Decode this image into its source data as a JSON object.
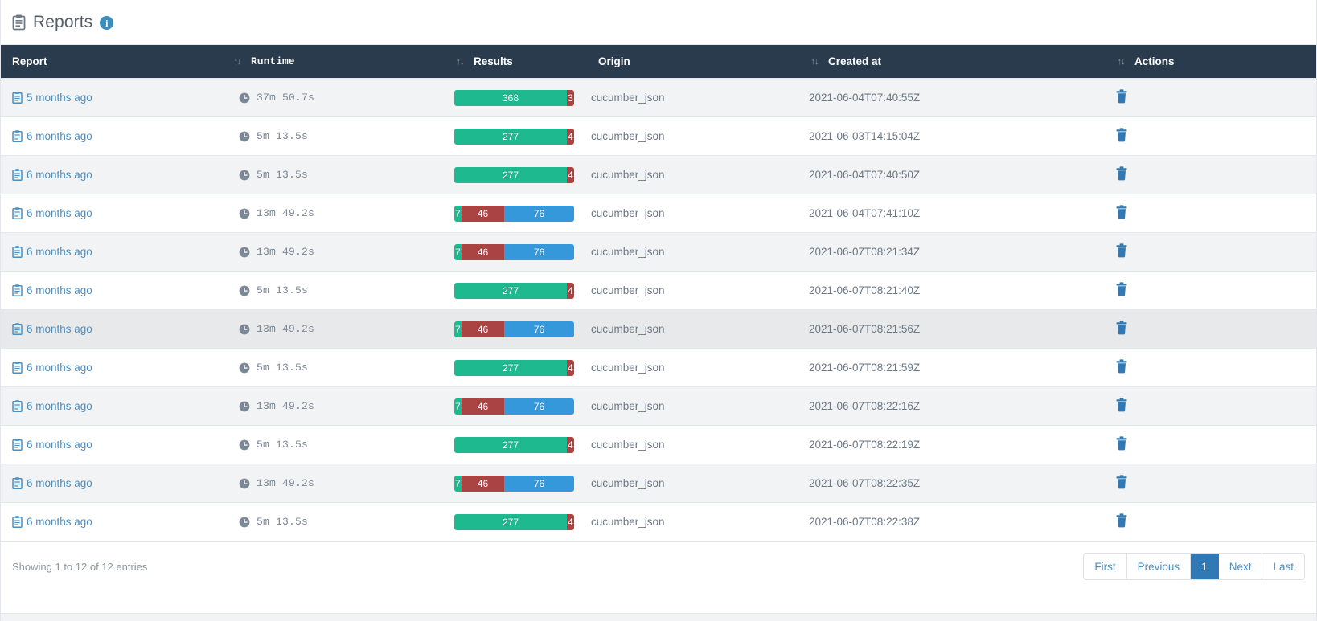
{
  "header": {
    "title": "Reports",
    "clipboard_icon": "clipboard-icon",
    "info_icon": "info-icon",
    "info_glyph": "i"
  },
  "table": {
    "columns": [
      {
        "label": "Report",
        "sortable": false,
        "sort_icon": ""
      },
      {
        "label": "Runtime",
        "sortable": true,
        "sort_icon": "sort-both-icon"
      },
      {
        "label": "Results",
        "sortable": true,
        "sort_icon": "sort-both-icon"
      },
      {
        "label": "Origin",
        "sortable": false,
        "sort_icon": ""
      },
      {
        "label": "Created at",
        "sortable": true,
        "sort_icon": "sort-both-icon"
      },
      {
        "label": "Actions",
        "sortable": true,
        "sort_icon": "sort-both-icon"
      }
    ],
    "rows": [
      {
        "report": "5 months ago",
        "runtime": "37m 50.7s",
        "results": {
          "passed": 368,
          "failed": 3,
          "skipped": 0
        },
        "origin": "cucumber_json",
        "created_at": "2021-06-04T07:40:55Z",
        "action": "delete-icon"
      },
      {
        "report": "6 months ago",
        "runtime": "5m 13.5s",
        "results": {
          "passed": 277,
          "failed": 4,
          "skipped": 0
        },
        "origin": "cucumber_json",
        "created_at": "2021-06-03T14:15:04Z",
        "action": "delete-icon"
      },
      {
        "report": "6 months ago",
        "runtime": "5m 13.5s",
        "results": {
          "passed": 277,
          "failed": 4,
          "skipped": 0
        },
        "origin": "cucumber_json",
        "created_at": "2021-06-04T07:40:50Z",
        "action": "delete-icon"
      },
      {
        "report": "6 months ago",
        "runtime": "13m 49.2s",
        "results": {
          "passed": 7,
          "failed": 46,
          "skipped": 76
        },
        "origin": "cucumber_json",
        "created_at": "2021-06-04T07:41:10Z",
        "action": "delete-icon"
      },
      {
        "report": "6 months ago",
        "runtime": "13m 49.2s",
        "results": {
          "passed": 7,
          "failed": 46,
          "skipped": 76
        },
        "origin": "cucumber_json",
        "created_at": "2021-06-07T08:21:34Z",
        "action": "delete-icon"
      },
      {
        "report": "6 months ago",
        "runtime": "5m 13.5s",
        "results": {
          "passed": 277,
          "failed": 4,
          "skipped": 0
        },
        "origin": "cucumber_json",
        "created_at": "2021-06-07T08:21:40Z",
        "action": "delete-icon"
      },
      {
        "report": "6 months ago",
        "runtime": "13m 49.2s",
        "results": {
          "passed": 7,
          "failed": 46,
          "skipped": 76
        },
        "origin": "cucumber_json",
        "created_at": "2021-06-07T08:21:56Z",
        "action": "delete-icon",
        "highlighted": true
      },
      {
        "report": "6 months ago",
        "runtime": "5m 13.5s",
        "results": {
          "passed": 277,
          "failed": 4,
          "skipped": 0
        },
        "origin": "cucumber_json",
        "created_at": "2021-06-07T08:21:59Z",
        "action": "delete-icon"
      },
      {
        "report": "6 months ago",
        "runtime": "13m 49.2s",
        "results": {
          "passed": 7,
          "failed": 46,
          "skipped": 76
        },
        "origin": "cucumber_json",
        "created_at": "2021-06-07T08:22:16Z",
        "action": "delete-icon"
      },
      {
        "report": "6 months ago",
        "runtime": "5m 13.5s",
        "results": {
          "passed": 277,
          "failed": 4,
          "skipped": 0
        },
        "origin": "cucumber_json",
        "created_at": "2021-06-07T08:22:19Z",
        "action": "delete-icon"
      },
      {
        "report": "6 months ago",
        "runtime": "13m 49.2s",
        "results": {
          "passed": 7,
          "failed": 46,
          "skipped": 76
        },
        "origin": "cucumber_json",
        "created_at": "2021-06-07T08:22:35Z",
        "action": "delete-icon"
      },
      {
        "report": "6 months ago",
        "runtime": "5m 13.5s",
        "results": {
          "passed": 277,
          "failed": 4,
          "skipped": 0
        },
        "origin": "cucumber_json",
        "created_at": "2021-06-07T08:22:38Z",
        "action": "delete-icon"
      }
    ]
  },
  "footer": {
    "showing": "Showing 1 to 12 of 12 entries",
    "pagination": [
      {
        "label": "First",
        "active": false
      },
      {
        "label": "Previous",
        "active": false
      },
      {
        "label": "1",
        "active": true
      },
      {
        "label": "Next",
        "active": false
      },
      {
        "label": "Last",
        "active": false
      }
    ]
  },
  "colors": {
    "header_bar": "#2b3b4e",
    "passed": "#1eb98f",
    "failed": "#a94442",
    "skipped": "#3498db",
    "link": "#4a8fc4",
    "accent": "#3179b5",
    "info_badge": "#3c8dbc"
  }
}
